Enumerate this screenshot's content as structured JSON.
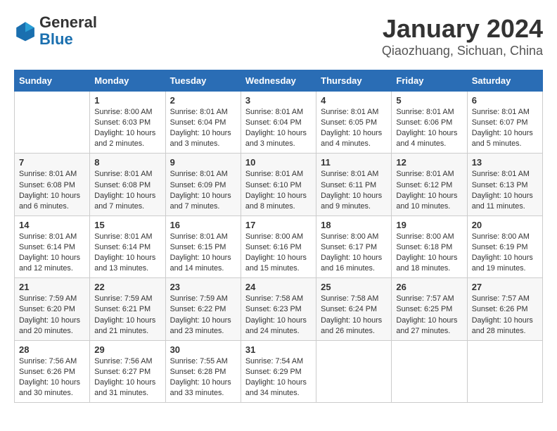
{
  "logo": {
    "general": "General",
    "blue": "Blue"
  },
  "title": "January 2024",
  "subtitle": "Qiaozhuang, Sichuan, China",
  "days_header": [
    "Sunday",
    "Monday",
    "Tuesday",
    "Wednesday",
    "Thursday",
    "Friday",
    "Saturday"
  ],
  "weeks": [
    [
      {
        "day": "",
        "info": ""
      },
      {
        "day": "1",
        "info": "Sunrise: 8:00 AM\nSunset: 6:03 PM\nDaylight: 10 hours\nand 2 minutes."
      },
      {
        "day": "2",
        "info": "Sunrise: 8:01 AM\nSunset: 6:04 PM\nDaylight: 10 hours\nand 3 minutes."
      },
      {
        "day": "3",
        "info": "Sunrise: 8:01 AM\nSunset: 6:04 PM\nDaylight: 10 hours\nand 3 minutes."
      },
      {
        "day": "4",
        "info": "Sunrise: 8:01 AM\nSunset: 6:05 PM\nDaylight: 10 hours\nand 4 minutes."
      },
      {
        "day": "5",
        "info": "Sunrise: 8:01 AM\nSunset: 6:06 PM\nDaylight: 10 hours\nand 4 minutes."
      },
      {
        "day": "6",
        "info": "Sunrise: 8:01 AM\nSunset: 6:07 PM\nDaylight: 10 hours\nand 5 minutes."
      }
    ],
    [
      {
        "day": "7",
        "info": "Sunrise: 8:01 AM\nSunset: 6:08 PM\nDaylight: 10 hours\nand 6 minutes."
      },
      {
        "day": "8",
        "info": "Sunrise: 8:01 AM\nSunset: 6:08 PM\nDaylight: 10 hours\nand 7 minutes."
      },
      {
        "day": "9",
        "info": "Sunrise: 8:01 AM\nSunset: 6:09 PM\nDaylight: 10 hours\nand 7 minutes."
      },
      {
        "day": "10",
        "info": "Sunrise: 8:01 AM\nSunset: 6:10 PM\nDaylight: 10 hours\nand 8 minutes."
      },
      {
        "day": "11",
        "info": "Sunrise: 8:01 AM\nSunset: 6:11 PM\nDaylight: 10 hours\nand 9 minutes."
      },
      {
        "day": "12",
        "info": "Sunrise: 8:01 AM\nSunset: 6:12 PM\nDaylight: 10 hours\nand 10 minutes."
      },
      {
        "day": "13",
        "info": "Sunrise: 8:01 AM\nSunset: 6:13 PM\nDaylight: 10 hours\nand 11 minutes."
      }
    ],
    [
      {
        "day": "14",
        "info": "Sunrise: 8:01 AM\nSunset: 6:14 PM\nDaylight: 10 hours\nand 12 minutes."
      },
      {
        "day": "15",
        "info": "Sunrise: 8:01 AM\nSunset: 6:14 PM\nDaylight: 10 hours\nand 13 minutes."
      },
      {
        "day": "16",
        "info": "Sunrise: 8:01 AM\nSunset: 6:15 PM\nDaylight: 10 hours\nand 14 minutes."
      },
      {
        "day": "17",
        "info": "Sunrise: 8:00 AM\nSunset: 6:16 PM\nDaylight: 10 hours\nand 15 minutes."
      },
      {
        "day": "18",
        "info": "Sunrise: 8:00 AM\nSunset: 6:17 PM\nDaylight: 10 hours\nand 16 minutes."
      },
      {
        "day": "19",
        "info": "Sunrise: 8:00 AM\nSunset: 6:18 PM\nDaylight: 10 hours\nand 18 minutes."
      },
      {
        "day": "20",
        "info": "Sunrise: 8:00 AM\nSunset: 6:19 PM\nDaylight: 10 hours\nand 19 minutes."
      }
    ],
    [
      {
        "day": "21",
        "info": "Sunrise: 7:59 AM\nSunset: 6:20 PM\nDaylight: 10 hours\nand 20 minutes."
      },
      {
        "day": "22",
        "info": "Sunrise: 7:59 AM\nSunset: 6:21 PM\nDaylight: 10 hours\nand 21 minutes."
      },
      {
        "day": "23",
        "info": "Sunrise: 7:59 AM\nSunset: 6:22 PM\nDaylight: 10 hours\nand 23 minutes."
      },
      {
        "day": "24",
        "info": "Sunrise: 7:58 AM\nSunset: 6:23 PM\nDaylight: 10 hours\nand 24 minutes."
      },
      {
        "day": "25",
        "info": "Sunrise: 7:58 AM\nSunset: 6:24 PM\nDaylight: 10 hours\nand 26 minutes."
      },
      {
        "day": "26",
        "info": "Sunrise: 7:57 AM\nSunset: 6:25 PM\nDaylight: 10 hours\nand 27 minutes."
      },
      {
        "day": "27",
        "info": "Sunrise: 7:57 AM\nSunset: 6:26 PM\nDaylight: 10 hours\nand 28 minutes."
      }
    ],
    [
      {
        "day": "28",
        "info": "Sunrise: 7:56 AM\nSunset: 6:26 PM\nDaylight: 10 hours\nand 30 minutes."
      },
      {
        "day": "29",
        "info": "Sunrise: 7:56 AM\nSunset: 6:27 PM\nDaylight: 10 hours\nand 31 minutes."
      },
      {
        "day": "30",
        "info": "Sunrise: 7:55 AM\nSunset: 6:28 PM\nDaylight: 10 hours\nand 33 minutes."
      },
      {
        "day": "31",
        "info": "Sunrise: 7:54 AM\nSunset: 6:29 PM\nDaylight: 10 hours\nand 34 minutes."
      },
      {
        "day": "",
        "info": ""
      },
      {
        "day": "",
        "info": ""
      },
      {
        "day": "",
        "info": ""
      }
    ]
  ]
}
